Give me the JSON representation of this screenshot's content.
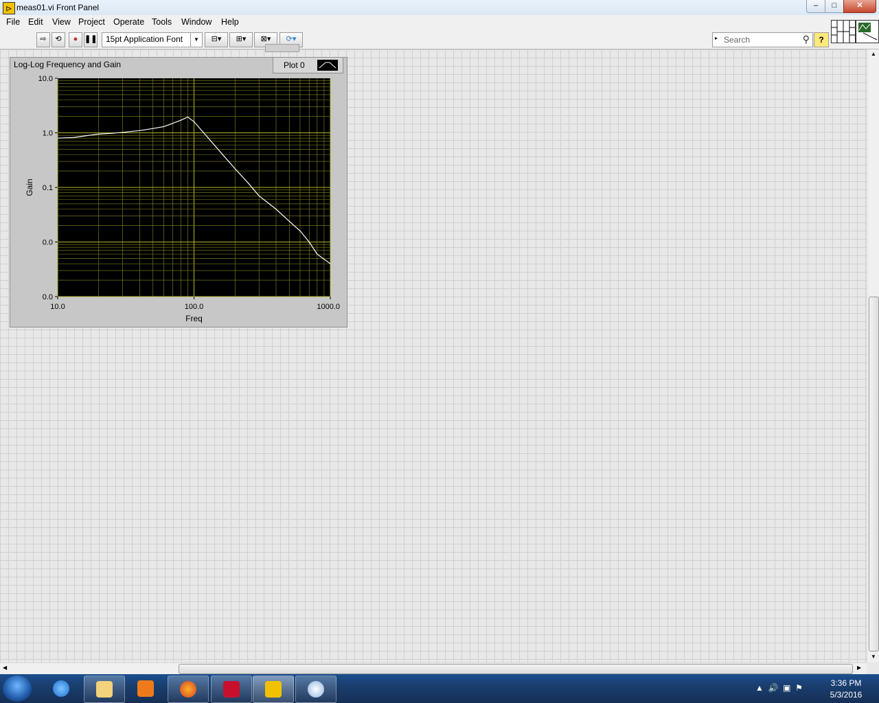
{
  "window": {
    "title": "meas01.vi Front Panel"
  },
  "menu": [
    "File",
    "Edit",
    "View",
    "Project",
    "Operate",
    "Tools",
    "Window",
    "Help"
  ],
  "toolbar": {
    "font_select": "15pt Application Font",
    "search_placeholder": "Search",
    "help": "?"
  },
  "graph": {
    "label": "Log-Log Frequency and Gain",
    "legend_plot_name": "Plot 0"
  },
  "chart_data": {
    "type": "line",
    "xlabel": "Freq",
    "ylabel": "Gain",
    "xscale": "log",
    "yscale": "log",
    "xlim": [
      10,
      1000
    ],
    "ylim": [
      0.001,
      10
    ],
    "x_tick_labels": [
      "10.0",
      "100.0",
      "1000.0"
    ],
    "y_tick_labels": [
      "10.0",
      "1.0",
      "0.1",
      "0.0",
      "0.0"
    ],
    "background": "#000000",
    "grid": true,
    "grid_color": "#8a8a20",
    "series": [
      {
        "name": "Plot 0",
        "color": "#ffffff",
        "x": [
          10,
          13,
          17,
          20,
          25,
          30,
          40,
          50,
          60,
          70,
          80,
          90,
          100,
          120,
          150,
          200,
          250,
          300,
          400,
          500,
          600,
          700,
          800,
          1000
        ],
        "y": [
          0.8,
          0.82,
          0.9,
          0.95,
          0.98,
          1.02,
          1.1,
          1.2,
          1.3,
          1.5,
          1.7,
          1.95,
          1.6,
          0.95,
          0.5,
          0.22,
          0.12,
          0.07,
          0.04,
          0.024,
          0.016,
          0.01,
          0.006,
          0.004
        ]
      }
    ]
  },
  "taskbar": {
    "time": "3:36 PM",
    "date": "5/3/2016"
  }
}
